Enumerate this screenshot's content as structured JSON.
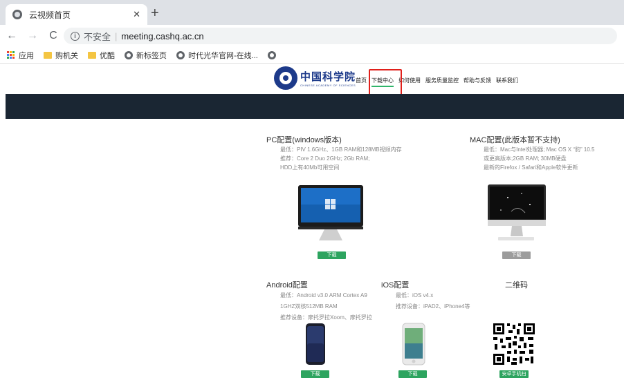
{
  "browser": {
    "tab_title": "云视频首页",
    "tab_close": "✕",
    "new_tab": "+",
    "back": "←",
    "forward": "→",
    "reload": "C",
    "info_glyph": "i",
    "insecure_label": "不安全",
    "separator": "|",
    "url": "meeting.cashq.ac.cn",
    "bookmarks": [
      {
        "label": "应用",
        "icon": "apps-icon"
      },
      {
        "label": "购机关",
        "icon": "folder-icon"
      },
      {
        "label": "优酷",
        "icon": "folder-icon"
      },
      {
        "label": "新标签页",
        "icon": "globe-icon"
      },
      {
        "label": "时代光华官网-在线...",
        "icon": "globe-icon"
      },
      {
        "label": "",
        "icon": "globe-icon"
      }
    ]
  },
  "site": {
    "logo_cn": "中国科学院",
    "logo_en": "CHINESE ACADEMY OF SCIENCES",
    "nav": [
      "首页",
      "下载中心",
      "如何使用",
      "服务质量监控",
      "帮助与反馈",
      "联系我们"
    ],
    "active_nav": "下载中心",
    "accent_color": "#2da45f",
    "highlight_color": "#e0201b",
    "banner_color": "#1a2633"
  },
  "downloads": {
    "pc": {
      "title": "PC配置(windows版本)",
      "lines": [
        "最低：PIV 1.6GHz、1GB RAM和128MB视频内存",
        "推荐：Core 2 Duo 2GHz; 2Gb RAM;",
        "HDD上有40Mb可用空间"
      ],
      "button": "下载"
    },
    "mac": {
      "title": "MAC配置(此版本暂不支持)",
      "lines": [
        "最低：Mac与Intel处理器; Mac OS X “豹” 10.5",
        "或更高版本;2GB RAM; 30MB硬盘",
        "最新的Firefox / Safari和Apple软件更新"
      ],
      "button": "下载"
    },
    "android": {
      "title": "Android配置",
      "lines": [
        "最低：Android v3.0 ARM Cortex A9",
        "1GHZ双核512MB RAM",
        "推荐设备：摩托罗拉Xoom、摩托罗拉"
      ],
      "button": "下载"
    },
    "ios": {
      "title": "iOS配置",
      "lines": [
        "最低：iOS v4.x",
        "推荐设备：iPAD2、iPhone4等"
      ],
      "button": "下载"
    },
    "qr": {
      "title": "二维码",
      "button": "安卓手机扫"
    }
  }
}
